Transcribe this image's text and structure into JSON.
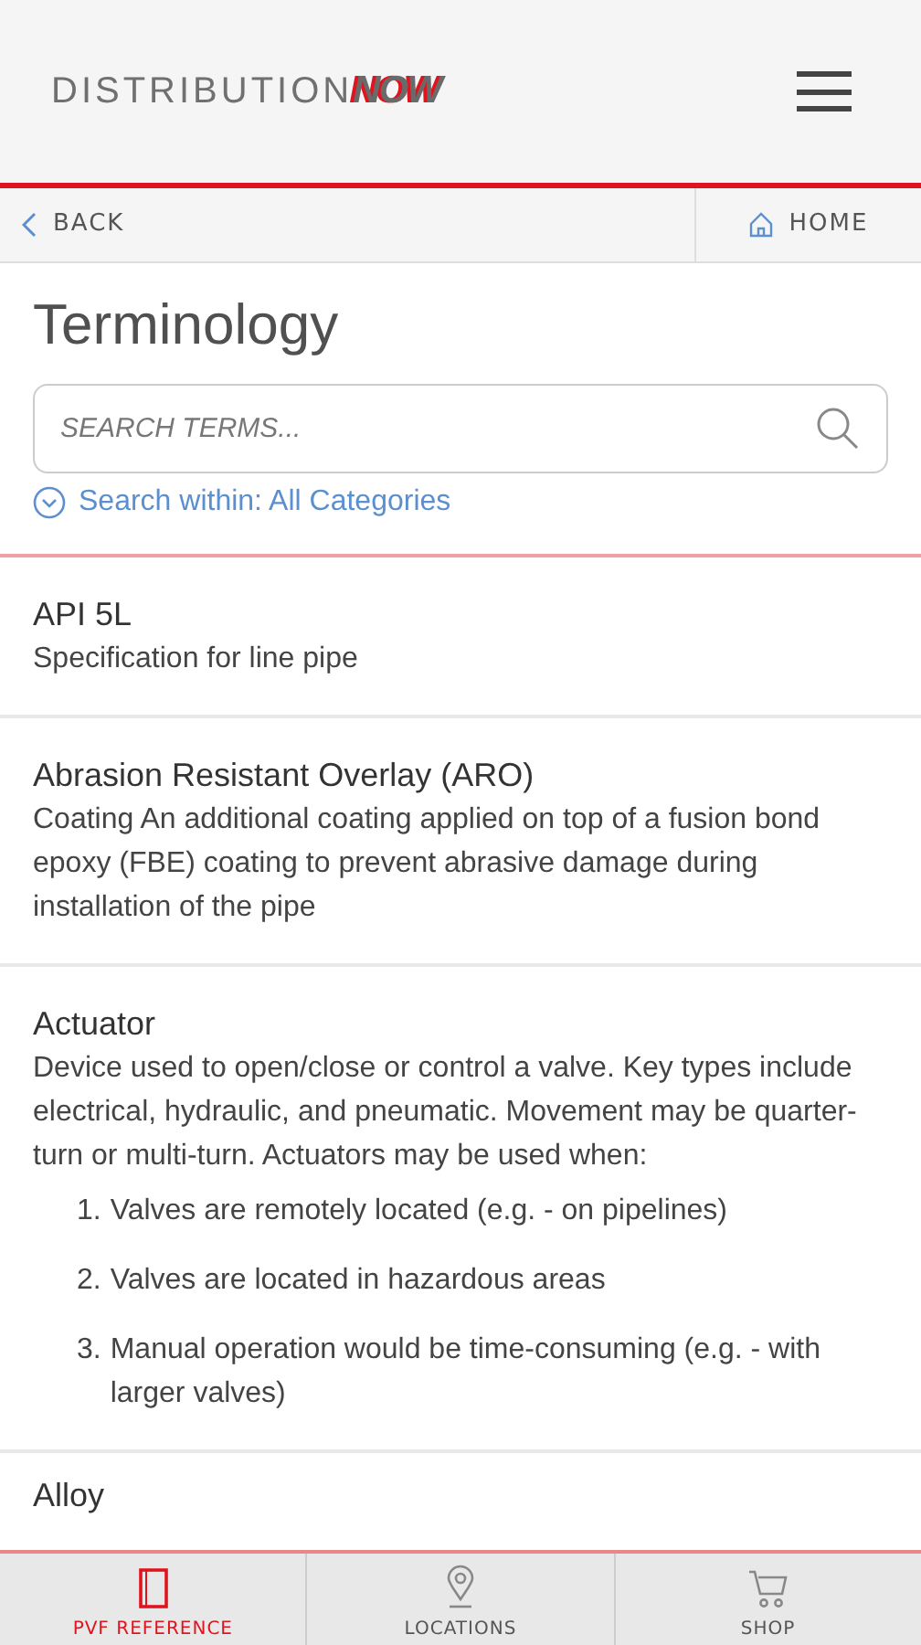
{
  "header": {
    "logo_light": "DISTRIBUTION",
    "logo_bold": "NOW"
  },
  "nav": {
    "back": "BACK",
    "home": "HOME"
  },
  "title": "Terminology",
  "search": {
    "placeholder": "SEARCH TERMS..."
  },
  "filter": {
    "label": "Search within: All Categories"
  },
  "terms": [
    {
      "term": "API 5L",
      "definition": "Specification for line pipe"
    },
    {
      "term": "Abrasion Resistant Overlay (ARO)",
      "definition": "Coating An additional coating applied on top of a fusion bond epoxy (FBE) coating to prevent abrasive damage during installation of the pipe"
    },
    {
      "term": "Actuator",
      "definition": "Device used to open/close or control a valve. Key types include electrical, hydraulic, and pneumatic. Movement may be quarter-turn or multi-turn. Actuators may be used when:",
      "list": [
        {
          "number": "1.",
          "text": "Valves are remotely located (e.g. - on pipelines)"
        },
        {
          "number": "2.",
          "text": "Valves are located in hazardous areas"
        },
        {
          "number": "3.",
          "text": "Manual operation would be time-consuming (e.g. - with larger valves)"
        }
      ]
    },
    {
      "term": "Alloy"
    }
  ],
  "tabs": [
    {
      "label": "PVF REFERENCE",
      "kind": "book",
      "selected": true
    },
    {
      "label": "LOCATIONS",
      "kind": "pin",
      "selected": false
    },
    {
      "label": "SHOP",
      "kind": "cart",
      "selected": false
    }
  ]
}
